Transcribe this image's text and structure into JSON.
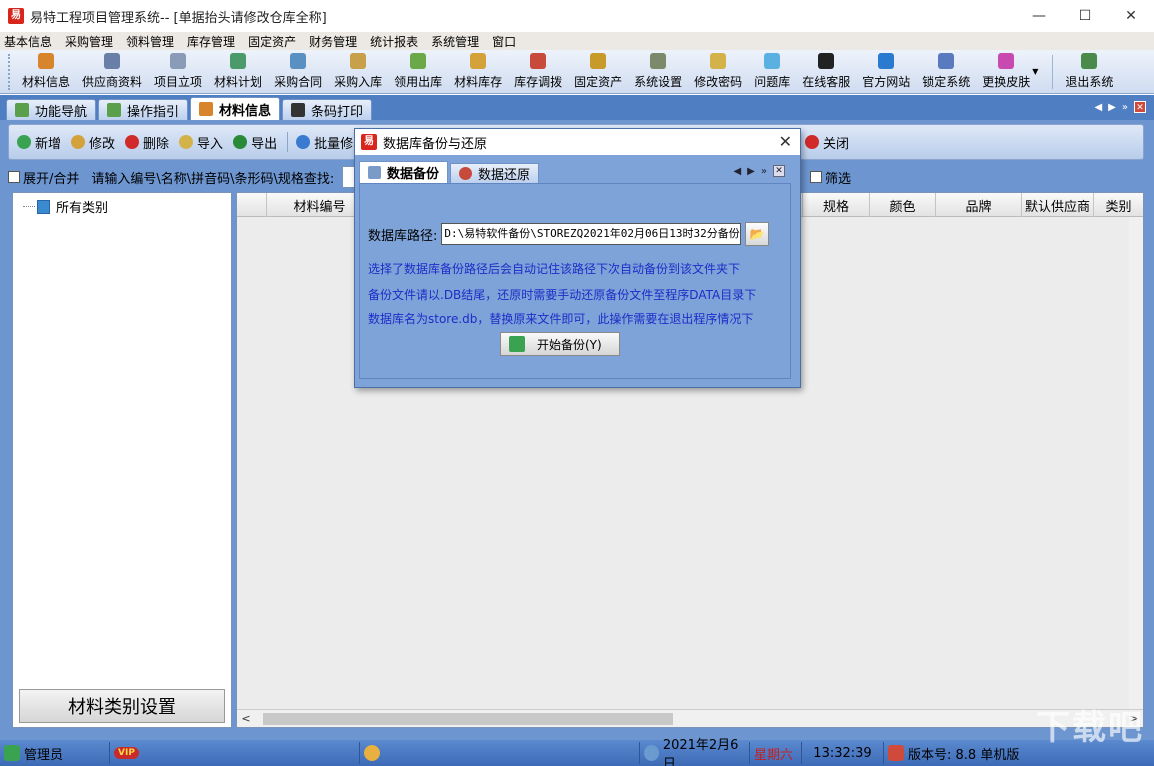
{
  "window": {
    "title": "易特工程项目管理系统-- [单据抬头请修改仓库全称]",
    "logo_text": "易",
    "minimize": "—",
    "maximize": "☐",
    "close": "✕"
  },
  "menu": [
    "基本信息",
    "采购管理",
    "领料管理",
    "库存管理",
    "固定资产",
    "财务管理",
    "统计报表",
    "系统管理",
    "窗口"
  ],
  "toolbar": [
    {
      "label": "材料信息",
      "icon": "material-icon",
      "color": "#d8842c"
    },
    {
      "label": "供应商资料",
      "icon": "supplier-icon",
      "color": "#6a7fa8"
    },
    {
      "label": "项目立项",
      "icon": "project-icon",
      "color": "#8a9bb8"
    },
    {
      "label": "材料计划",
      "icon": "plan-icon",
      "color": "#4a9a6a"
    },
    {
      "label": "采购合同",
      "icon": "contract-icon",
      "color": "#5a8fc2"
    },
    {
      "label": "采购入库",
      "icon": "truck-icon",
      "color": "#c8a04a"
    },
    {
      "label": "领用出库",
      "icon": "outbound-icon",
      "color": "#6aa84a"
    },
    {
      "label": "材料库存",
      "icon": "inventory-icon",
      "color": "#d4a23a"
    },
    {
      "label": "库存调拨",
      "icon": "transfer-icon",
      "color": "#c84a3a"
    },
    {
      "label": "固定资产",
      "icon": "asset-icon",
      "color": "#c89a2a"
    },
    {
      "label": "系统设置",
      "icon": "settings-icon",
      "color": "#7a8a6a"
    },
    {
      "label": "修改密码",
      "icon": "password-icon",
      "color": "#d4b24a"
    },
    {
      "label": "问题库",
      "icon": "question-icon",
      "color": "#5ab0e0"
    },
    {
      "label": "在线客服",
      "icon": "qq-icon",
      "color": "#222222"
    },
    {
      "label": "官方网站",
      "icon": "ie-icon",
      "color": "#2a7ad0"
    },
    {
      "label": "锁定系统",
      "icon": "lock-icon",
      "color": "#5a7ac0"
    },
    {
      "label": "更换皮肤",
      "icon": "skin-icon",
      "color": "#c84ab0"
    },
    {
      "label": "退出系统",
      "icon": "exit-icon",
      "color": "#4a8a4a"
    }
  ],
  "tabs": [
    {
      "label": "功能导航",
      "icon": "nav-icon",
      "active": false,
      "color": "#5aa04a"
    },
    {
      "label": "操作指引",
      "icon": "guide-icon",
      "active": false,
      "color": "#5aa04a"
    },
    {
      "label": "材料信息",
      "icon": "material-tab-icon",
      "active": true,
      "color": "#d8842c"
    },
    {
      "label": "条码打印",
      "icon": "barcode-icon",
      "active": false,
      "color": "#333333"
    }
  ],
  "tabs_nav": {
    "prev": "◀",
    "next": "▶",
    "menu": "»",
    "close": "✕"
  },
  "actions": [
    {
      "label": "新增",
      "icon": "add-icon",
      "color": "#3aa352"
    },
    {
      "label": "修改",
      "icon": "edit-icon",
      "color": "#d4a23a"
    },
    {
      "label": "删除",
      "icon": "delete-icon",
      "color": "#d02a2a"
    },
    {
      "label": "导入",
      "icon": "import-icon",
      "color": "#d4b24a"
    },
    {
      "label": "导出",
      "icon": "export-icon",
      "color": "#2a8a3a"
    },
    {
      "label": "批量修改",
      "icon": "batch-icon",
      "color": "#3a7ad0"
    }
  ],
  "close_action": {
    "label": "关闭",
    "icon": "close-action-icon",
    "color": "#d02a2a"
  },
  "search": {
    "expand_label": "展开/合并",
    "hint": "请输入编号\\名称\\拼音码\\条形码\\规格查找:",
    "filter_label": "筛选"
  },
  "tree": {
    "root": "所有类别",
    "category_button": "材料类别设置"
  },
  "grid": {
    "columns": [
      "",
      "材料编号",
      "规格",
      "颜色",
      "品牌",
      "默认供应商",
      "类别"
    ],
    "scroll_left": "<",
    "scroll_right": ">"
  },
  "status": {
    "user": "管理员",
    "vip": "VIP",
    "date": "2021年2月6日",
    "weekday": "星期六",
    "time": "13:32:39",
    "version": "版本号: 8.8 单机版"
  },
  "dialog": {
    "title": "数据库备份与还原",
    "close": "✕",
    "tabs": [
      {
        "label": "数据备份",
        "active": true
      },
      {
        "label": "数据还原",
        "active": false
      }
    ],
    "path_label": "数据库路径:",
    "path_value": "D:\\易特软件备份\\STOREZQ2021年02月06日13时32分备份",
    "hints": [
      "选择了数据库备份路径后会自动记住该路径下次自动备份到该文件夹下",
      "备份文件请以.DB结尾，还原时需要手动还原备份文件至程序DATA目录下",
      "数据库名为store.db，替换原来文件即可，此操作需要在退出程序情况下"
    ],
    "start_button": "开始备份(Y)",
    "hint_color": "#1e2cc8"
  },
  "watermark": "下载吧"
}
